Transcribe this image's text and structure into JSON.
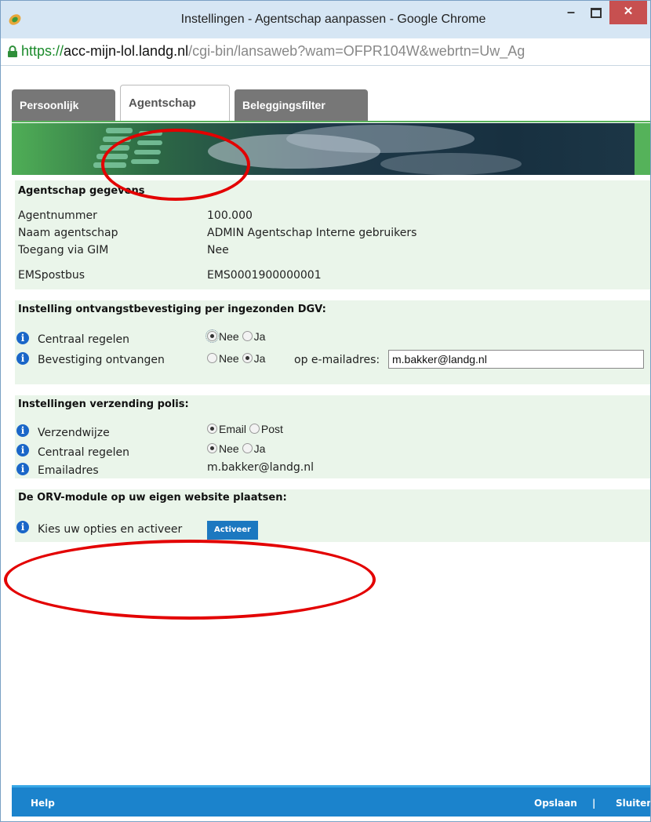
{
  "window": {
    "title": "Instellingen - Agentschap aanpassen - Google Chrome",
    "minimize": "–",
    "close": "✕"
  },
  "address": {
    "scheme": "https://",
    "host": "acc-mijn-lol.landg.nl",
    "path": "/cgi-bin/lansaweb?wam=OFPR104W&webrtn=Uw_Ag"
  },
  "tabs": [
    {
      "label": "Persoonlijk"
    },
    {
      "label": "Agentschap",
      "active": true
    },
    {
      "label": "Beleggingsfilter"
    }
  ],
  "agentschap": {
    "heading": "Agentschap gegevens",
    "rows": [
      {
        "label": "Agentnummer",
        "value": "100.000"
      },
      {
        "label": "Naam agentschap",
        "value": "ADMIN Agentschap Interne gebruikers"
      },
      {
        "label": "Toegang via GIM",
        "value": "Nee"
      },
      {
        "label": "EMSpostbus",
        "value": "EMS0001900000001"
      }
    ]
  },
  "ontvangst": {
    "heading": "Instelling ontvangstbevestiging per ingezonden DGV:",
    "centraal_label": "Centraal regelen",
    "bevestiging_label": "Bevestiging ontvangen",
    "opt_nee": "Nee",
    "opt_ja": "Ja",
    "centraal_selected": "Nee",
    "bevestiging_selected": "Ja",
    "email_label": "op e-mailadres:",
    "email_value": "m.bakker@landg.nl"
  },
  "verzending": {
    "heading": "Instellingen verzending polis:",
    "verzendwijze_label": "Verzendwijze",
    "opt_email": "Email",
    "opt_post": "Post",
    "verzendwijze_selected": "Email",
    "centraal_label": "Centraal regelen",
    "opt_nee": "Nee",
    "opt_ja": "Ja",
    "centraal_selected": "Nee",
    "emailadres_label": "Emailadres",
    "emailadres_value": "m.bakker@landg.nl"
  },
  "orv": {
    "heading": "De ORV-module op uw eigen website plaatsen:",
    "label": "Kies uw opties en activeer",
    "button": "Activeer"
  },
  "footer": {
    "help": "Help",
    "save": "Opslaan",
    "separator": "|",
    "close": "Sluiten"
  },
  "colors": {
    "accent": "#1b83cc",
    "panel": "#eaf5ea",
    "banner": "#55b25a",
    "annotation": "#e30000"
  }
}
